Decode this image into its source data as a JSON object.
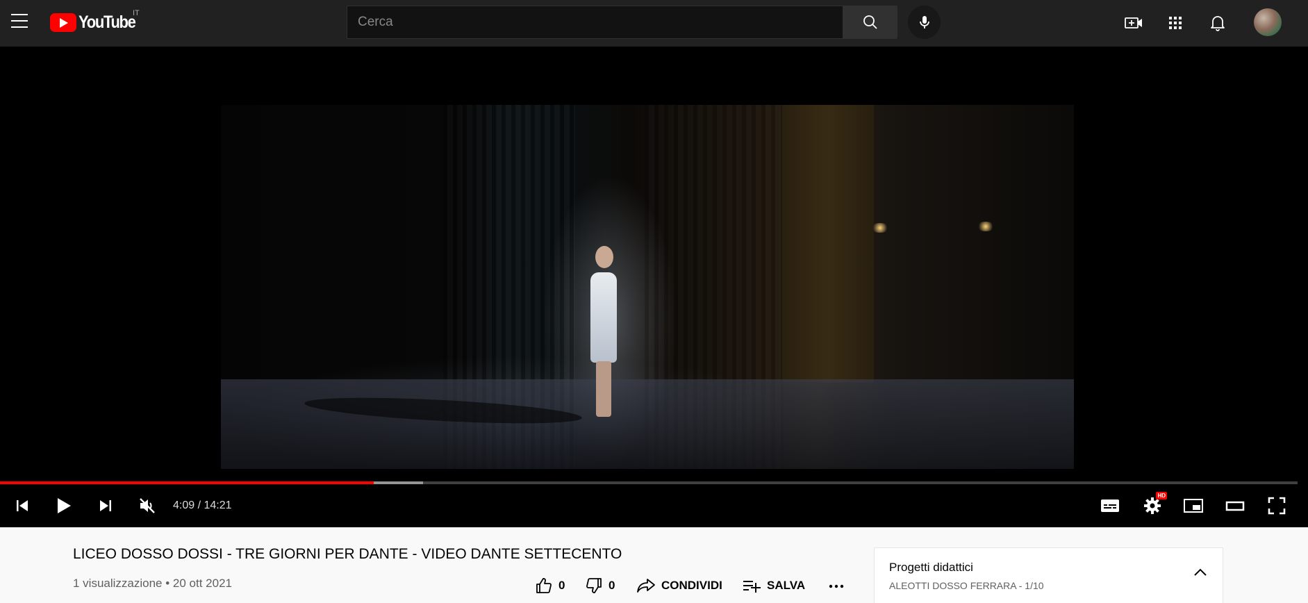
{
  "header": {
    "logo_text": "YouTube",
    "country_code": "IT",
    "search_placeholder": "Cerca",
    "search_value": ""
  },
  "player": {
    "time_current": "4:09",
    "time_separator": " / ",
    "time_total": "14:21",
    "progress_played_fraction": 0.288,
    "progress_loaded_fraction": 0.326,
    "hd_badge": "HD",
    "muted": true
  },
  "video": {
    "title": "LICEO DOSSO DOSSI - TRE GIORNI PER DANTE - VIDEO DANTE SETTECENTO",
    "views": "1 visualizzazione",
    "meta_separator": " • ",
    "date": "20 ott 2021",
    "likes": "0",
    "dislikes": "0",
    "share_label": "CONDIVIDI",
    "save_label": "SALVA"
  },
  "playlist": {
    "title": "Progetti didattici",
    "channel": "ALEOTTI DOSSO FERRARA",
    "separator": " - ",
    "position": "1/10"
  },
  "colors": {
    "brand_red": "#ff0000",
    "topbar": "#212121",
    "player_bg": "#000000",
    "page_bg": "#f9f9f9"
  }
}
